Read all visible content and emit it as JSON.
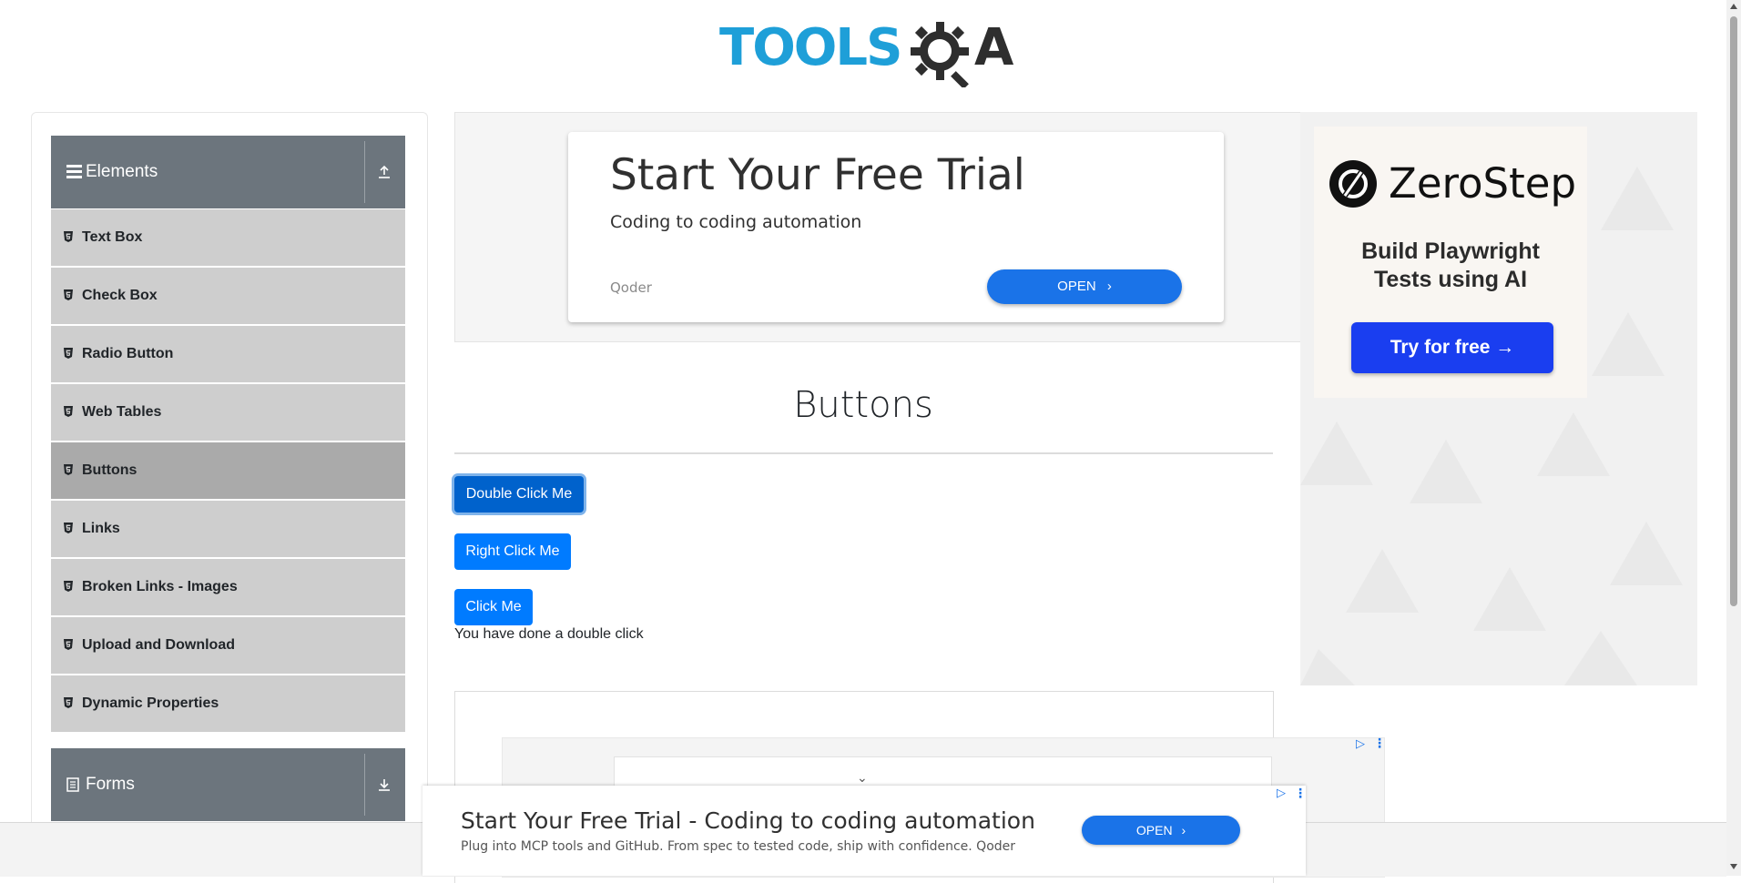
{
  "header": {
    "logo_tools": "TOOLS",
    "logo_qa": "A"
  },
  "sidebar": {
    "elements_group": "Elements",
    "items": [
      {
        "label": "Text Box"
      },
      {
        "label": "Check Box"
      },
      {
        "label": "Radio Button"
      },
      {
        "label": "Web Tables"
      },
      {
        "label": "Buttons",
        "active": true
      },
      {
        "label": "Links"
      },
      {
        "label": "Broken Links - Images"
      },
      {
        "label": "Upload and Download"
      },
      {
        "label": "Dynamic Properties"
      }
    ],
    "forms_group": "Forms"
  },
  "top_ad": {
    "title": "Start Your Free Trial",
    "subtitle": "Coding to coding automation",
    "brand": "Qoder",
    "button": "OPEN"
  },
  "right_ad": {
    "brand": "ZeroStep",
    "tagline_line1": "Build Playwright",
    "tagline_line2": "Tests using AI",
    "button": "Try for free →"
  },
  "main": {
    "title": "Buttons",
    "double_click_button": "Double Click Me",
    "right_click_button": "Right Click Me",
    "click_button": "Click Me",
    "result_message": "You have done a double click"
  },
  "bottom_ad": {
    "title": "Start Your Free Trial - Coding to coding automation",
    "subtitle": "Plug into MCP tools and GitHub. From spec to tested code, ship with confidence. Qoder",
    "button": "OPEN"
  },
  "colors": {
    "primary_button": "#007bff",
    "sidebar_header": "#6c757d",
    "sidebar_item": "#cecece",
    "sidebar_item_active": "#aaaaaa",
    "logo_blue": "#1e9fd8"
  }
}
